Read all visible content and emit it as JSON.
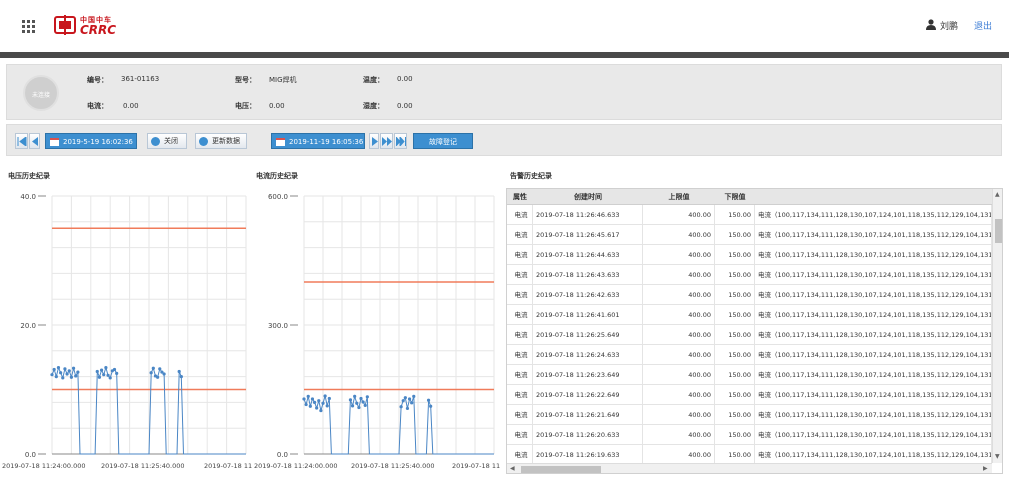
{
  "header": {
    "logo_cn": "中国中车",
    "logo_en": "CRRC",
    "user": "刘鹏",
    "logout": "退出"
  },
  "info": {
    "avatar_text": "未连接",
    "fields": [
      {
        "label": "编号：",
        "value": "361-01163"
      },
      {
        "label": "型号：",
        "value": "MIG焊机"
      },
      {
        "label": "温度：",
        "value": "0.00"
      },
      {
        "label": "电流：",
        "value": "0.00"
      },
      {
        "label": "电压：",
        "value": "0.00"
      },
      {
        "label": "湿度：",
        "value": "0.00"
      }
    ]
  },
  "toolbar": {
    "start_date": "2019-5-19 16:02:36",
    "close": "关闭",
    "refresh": "更新数据",
    "end_date": "2019-11-19 16:05:36",
    "fault_register": "故障登记"
  },
  "voltage_chart": {
    "title": "电压历史纪录"
  },
  "current_chart": {
    "title": "电流历史纪录"
  },
  "alarm_grid": {
    "title": "告警历史纪录",
    "columns": [
      "属性",
      "创建时间",
      "上限值",
      "下限值",
      ""
    ],
    "rows": [
      {
        "attr": "电流",
        "time": "2019-07-18 11:26:46.633",
        "upper": "400.00",
        "lower": "150.00",
        "detail": "电流（100,117,134,111,128,130,107,124,101,118,135,112,129,104,131,138,1"
      },
      {
        "attr": "电流",
        "time": "2019-07-18 11:26:45.617",
        "upper": "400.00",
        "lower": "150.00",
        "detail": "电流（100,117,134,111,128,130,107,124,101,118,135,112,129,104,131,138,1"
      },
      {
        "attr": "电流",
        "time": "2019-07-18 11:26:44.633",
        "upper": "400.00",
        "lower": "150.00",
        "detail": "电流（100,117,134,111,128,130,107,124,101,118,135,112,129,104,131,138,1"
      },
      {
        "attr": "电流",
        "time": "2019-07-18 11:26:43.633",
        "upper": "400.00",
        "lower": "150.00",
        "detail": "电流（100,117,134,111,128,130,107,124,101,118,135,112,129,104,131,138,1"
      },
      {
        "attr": "电流",
        "time": "2019-07-18 11:26:42.633",
        "upper": "400.00",
        "lower": "150.00",
        "detail": "电流（100,117,134,111,128,130,107,124,101,118,135,112,129,104,131,138,1"
      },
      {
        "attr": "电流",
        "time": "2019-07-18 11:26:41.601",
        "upper": "400.00",
        "lower": "150.00",
        "detail": "电流（100,117,134,111,128,130,107,124,101,118,135,112,129,104,131,138,1"
      },
      {
        "attr": "电流",
        "time": "2019-07-18 11:26:25.649",
        "upper": "400.00",
        "lower": "150.00",
        "detail": "电流（100,117,134,111,128,130,107,124,101,118,135,112,129,104,131,138,1"
      },
      {
        "attr": "电流",
        "time": "2019-07-18 11:26:24.633",
        "upper": "400.00",
        "lower": "150.00",
        "detail": "电流（100,117,134,111,128,130,107,124,101,118,135,112,129,104,131,138,1"
      },
      {
        "attr": "电流",
        "time": "2019-07-18 11:26:23.649",
        "upper": "400.00",
        "lower": "150.00",
        "detail": "电流（100,117,134,111,128,130,107,124,101,118,135,112,129,104,131,138,1"
      },
      {
        "attr": "电流",
        "time": "2019-07-18 11:26:22.649",
        "upper": "400.00",
        "lower": "150.00",
        "detail": "电流（100,117,134,111,128,130,107,124,101,118,135,112,129,104,131,138,1"
      },
      {
        "attr": "电流",
        "time": "2019-07-18 11:26:21.649",
        "upper": "400.00",
        "lower": "150.00",
        "detail": "电流（100,117,134,111,128,130,107,124,101,118,135,112,129,104,131,138,1"
      },
      {
        "attr": "电流",
        "time": "2019-07-18 11:26:20.633",
        "upper": "400.00",
        "lower": "150.00",
        "detail": "电流（100,117,134,111,128,130,107,124,101,118,135,112,129,104,131,138,1"
      },
      {
        "attr": "电流",
        "time": "2019-07-18 11:26:19.633",
        "upper": "400.00",
        "lower": "150.00",
        "detail": "电流（100,117,134,111,128,130,107,124,101,118,135,112,129,104,131,138,1"
      }
    ]
  },
  "chart_data": [
    {
      "type": "line",
      "title": "",
      "ylim": [
        0,
        40
      ],
      "yticks": [
        "40.0",
        "20.0",
        "0.0"
      ],
      "xticks": [
        "2019-07-18 11:24:00.000",
        "2019-07-18 11:25:40.000",
        "2019-07-18 11"
      ],
      "threshold_upper": 35,
      "threshold_lower": 10,
      "colors": {
        "series": "#4a86c5",
        "threshold": "#f07b5a",
        "grid": "#e6e6e6"
      },
      "x": [
        0,
        2,
        4,
        6,
        8,
        10,
        12,
        14,
        16,
        18,
        20,
        22,
        24,
        26,
        28,
        30,
        32,
        34,
        36,
        38,
        40,
        42,
        44,
        46,
        48,
        50,
        52,
        54,
        56,
        58,
        60,
        62,
        64,
        66,
        68,
        70,
        72,
        74,
        76,
        78,
        80,
        82,
        84,
        86,
        88,
        90,
        92,
        94,
        96,
        98,
        100,
        102,
        104,
        106,
        108,
        110,
        112,
        114,
        116,
        118,
        120,
        122,
        124,
        126,
        128,
        130,
        132,
        134,
        136,
        138,
        140,
        142,
        144,
        146,
        148,
        150,
        152,
        154,
        156,
        158,
        160,
        162,
        164,
        166,
        168,
        170,
        172,
        174,
        176,
        178,
        180
      ],
      "values": [
        12.3,
        13.1,
        12.0,
        13.4,
        12.6,
        11.8,
        13.2,
        12.4,
        12.9,
        11.9,
        13.3,
        12.1,
        12.7,
        0,
        0,
        0,
        0,
        0,
        0,
        0,
        0,
        12.8,
        11.9,
        13.0,
        12.3,
        13.4,
        12.2,
        11.8,
        12.9,
        13.1,
        12.5,
        0,
        0,
        0,
        0,
        0,
        0,
        0,
        0,
        0,
        0,
        0,
        0,
        0,
        0,
        0,
        12.6,
        13.3,
        12.1,
        11.9,
        13.2,
        12.7,
        12.4,
        0,
        0,
        0,
        0,
        0,
        0,
        12.8,
        12.0,
        0,
        0,
        0,
        0,
        0,
        0,
        0,
        0,
        0,
        0,
        0,
        0,
        0,
        0,
        0,
        0,
        0,
        0,
        0,
        0,
        0,
        0,
        0,
        0,
        0,
        0,
        0,
        0,
        0,
        0
      ],
      "ylabel": ""
    },
    {
      "type": "line",
      "title": "",
      "ylim": [
        0,
        600
      ],
      "yticks": [
        "600.0",
        "300.0",
        "0.0"
      ],
      "xticks": [
        "2019-07-18 11:24:00.000",
        "2019-07-18 11:25:40.000",
        "2019-07-18 11"
      ],
      "threshold_upper": 400,
      "threshold_lower": 150,
      "colors": {
        "series": "#4a86c5",
        "threshold": "#f07b5a",
        "grid": "#e6e6e6"
      },
      "x": [
        0,
        2,
        4,
        6,
        8,
        10,
        12,
        14,
        16,
        18,
        20,
        22,
        24,
        26,
        28,
        30,
        32,
        34,
        36,
        38,
        40,
        42,
        44,
        46,
        48,
        50,
        52,
        54,
        56,
        58,
        60,
        62,
        64,
        66,
        68,
        70,
        72,
        74,
        76,
        78,
        80,
        82,
        84,
        86,
        88,
        90,
        92,
        94,
        96,
        98,
        100,
        102,
        104,
        106,
        108,
        110,
        112,
        114,
        116,
        118,
        120,
        122,
        124,
        126,
        128,
        130,
        132,
        134,
        136,
        138,
        140,
        142,
        144,
        146,
        148,
        150,
        152,
        154,
        156,
        158,
        160,
        162,
        164,
        166,
        168,
        170,
        172,
        174,
        176,
        178,
        180
      ],
      "values": [
        128,
        115,
        134,
        111,
        128,
        120,
        107,
        124,
        101,
        118,
        135,
        112,
        129,
        0,
        0,
        0,
        0,
        0,
        0,
        0,
        0,
        0,
        126,
        112,
        134,
        118,
        108,
        129,
        121,
        113,
        133,
        0,
        0,
        0,
        0,
        0,
        0,
        0,
        0,
        0,
        0,
        0,
        0,
        0,
        0,
        0,
        110,
        124,
        131,
        106,
        128,
        119,
        134,
        0,
        0,
        0,
        0,
        0,
        0,
        125,
        111,
        0,
        0,
        0,
        0,
        0,
        0,
        0,
        0,
        0,
        0,
        0,
        0,
        0,
        0,
        0,
        0,
        0,
        0,
        0,
        0,
        0,
        0,
        0,
        0,
        0,
        0,
        0,
        0,
        0,
        0
      ],
      "ylabel": ""
    }
  ]
}
